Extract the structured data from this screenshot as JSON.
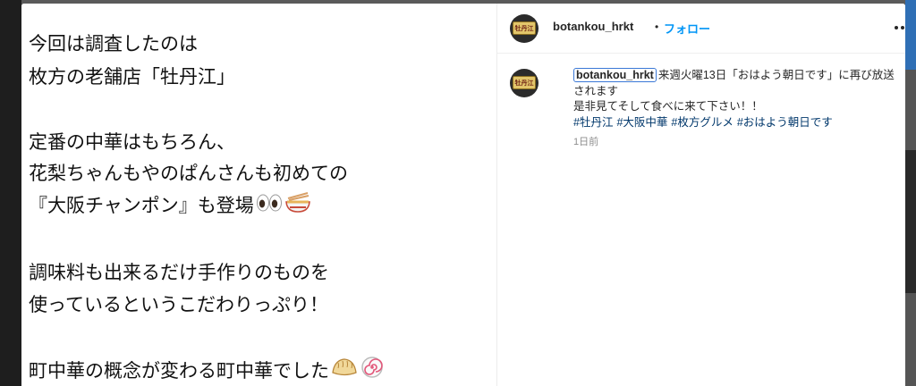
{
  "post_image": {
    "caption_lines": [
      "今回は調査したのは",
      "枚方の老舗店「牡丹江」",
      "",
      "定番の中華はもちろん、",
      "花梨ちゃんもやのぱんさんも初めての",
      "『大阪チャンポン』も登場",
      "",
      "調味料も出来るだけ手作りのものを",
      "使っているというこだわりっぷり！",
      "",
      "町中華の概念が変わる町中華でした"
    ],
    "emojis": [
      "eyes-emoji",
      "noodle-bowl-emoji",
      "gyoza-emoji",
      "narutomaki-emoji"
    ]
  },
  "header": {
    "username": "botankou_hrkt",
    "separator": "•",
    "follow_label": "フォロー",
    "avatar_text": "牡丹江"
  },
  "comment": {
    "username": "botankou_hrkt",
    "text_line1": "来週火曜13日「おはよう朝日です」に再び放送",
    "text_line2": "されます",
    "text_line3": "是非見てそして食べに来て下さい！！",
    "hashtags": [
      "#牡丹江",
      "#大阪中華",
      "#枚方グルメ",
      "#おはよう朝日です"
    ],
    "time": "1日前"
  }
}
